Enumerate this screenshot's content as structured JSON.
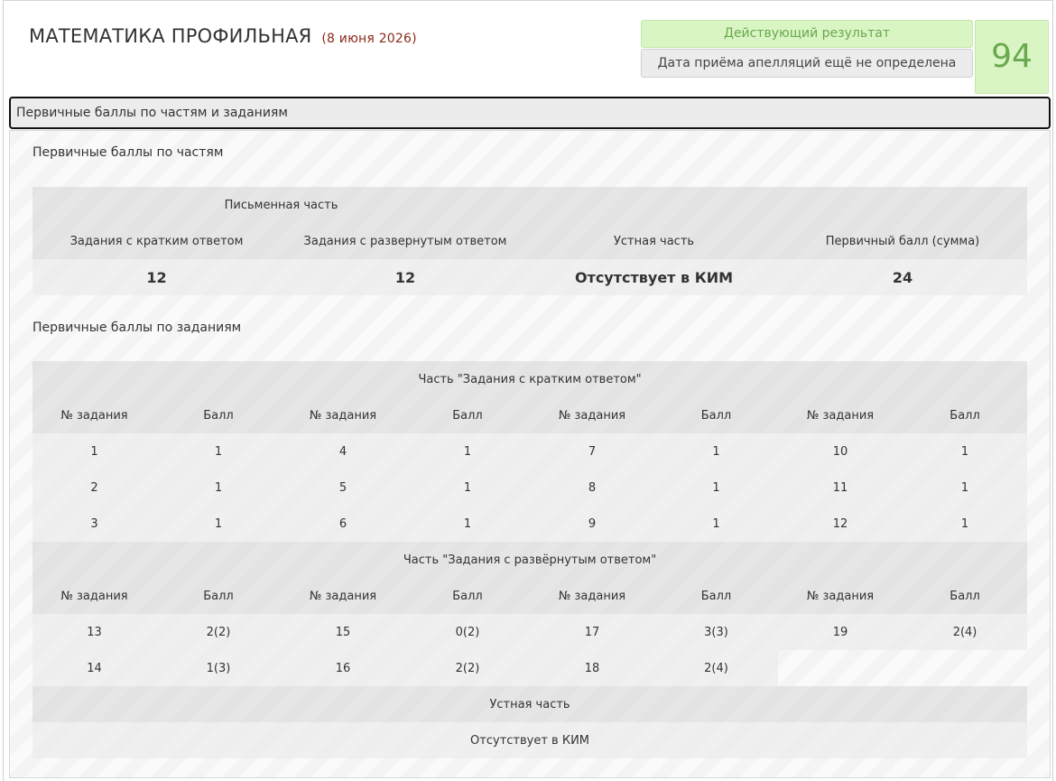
{
  "header": {
    "subject": "МАТЕМАТИКА ПРОФИЛЬНАЯ",
    "date": "(8 июня 2026)",
    "status": "Действующий результат",
    "appeal": "Дата приёма апелляций ещё не определена",
    "score": "94"
  },
  "colors": {
    "accent_green": "#6aa84f",
    "status_bg": "#d9f5c3",
    "date_red": "#8a2a1a"
  },
  "accordion": {
    "title": "Первичные баллы по частям и заданиям"
  },
  "parts": {
    "section_title": "Первичные баллы по частям",
    "written_label": "Письменная часть",
    "headers": [
      "Задания с кратким ответом",
      "Задания с развернутым ответом",
      "Устная часть",
      "Первичный балл (сумма)"
    ],
    "values": [
      "12",
      "12",
      "Отсутствует в КИМ",
      "24"
    ]
  },
  "tasks": {
    "section_title": "Первичные баллы по заданиям",
    "col_task": "№ задания",
    "col_score": "Балл",
    "short": {
      "title": "Часть \"Задания с кратким ответом\"",
      "rows": [
        [
          "1",
          "1",
          "4",
          "1",
          "7",
          "1",
          "10",
          "1"
        ],
        [
          "2",
          "1",
          "5",
          "1",
          "8",
          "1",
          "11",
          "1"
        ],
        [
          "3",
          "1",
          "6",
          "1",
          "9",
          "1",
          "12",
          "1"
        ]
      ]
    },
    "long": {
      "title": "Часть \"Задания с развёрнутым ответом\"",
      "rows": [
        [
          "13",
          "2(2)",
          "15",
          "0(2)",
          "17",
          "3(3)",
          "19",
          "2(4)"
        ],
        [
          "14",
          "1(3)",
          "16",
          "2(2)",
          "18",
          "2(4)"
        ]
      ]
    },
    "oral": {
      "title": "Устная часть",
      "value": "Отсутствует в КИМ"
    }
  }
}
